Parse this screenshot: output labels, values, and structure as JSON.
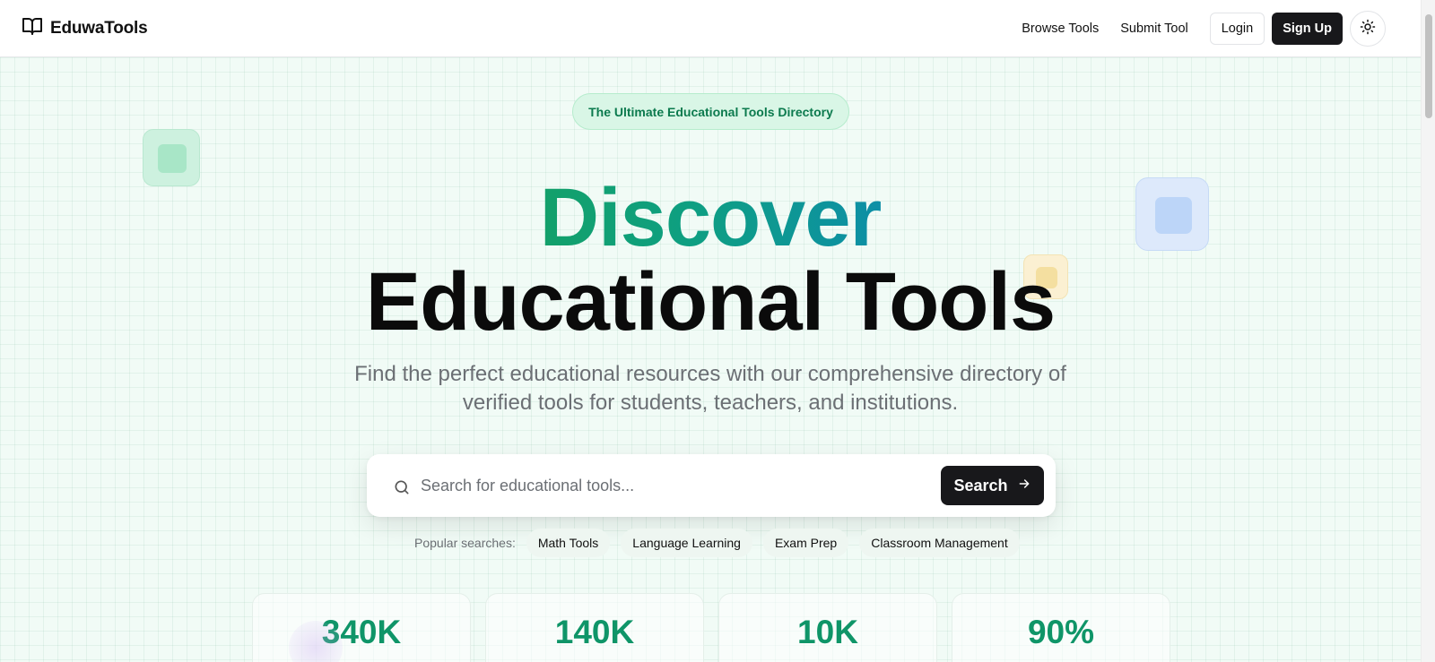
{
  "header": {
    "brand": "EduwaTools",
    "nav": [
      "Browse Tools",
      "Submit Tool"
    ],
    "login": "Login",
    "signup": "Sign Up"
  },
  "hero": {
    "badge": "The Ultimate Educational Tools Directory",
    "title_accent": "Discover",
    "title_main": "Educational Tools",
    "subtitle": "Find the perfect educational resources with our comprehensive directory of verified tools for students, teachers, and institutions."
  },
  "search": {
    "placeholder": "Search for educational tools...",
    "button": "Search"
  },
  "popular": {
    "label": "Popular searches:",
    "items": [
      "Math Tools",
      "Language Learning",
      "Exam Prep",
      "Classroom Management"
    ]
  },
  "stats": [
    {
      "value": "340K"
    },
    {
      "value": "140K"
    },
    {
      "value": "10K"
    },
    {
      "value": "90%"
    }
  ],
  "colors": {
    "accent_green": "#0f9568",
    "dark": "#18181b",
    "hero_bg": "#f1fbf6"
  },
  "icons": {
    "logo": "book-open-icon",
    "theme": "sun-icon",
    "search": "search-icon",
    "arrow": "arrow-right-icon"
  }
}
